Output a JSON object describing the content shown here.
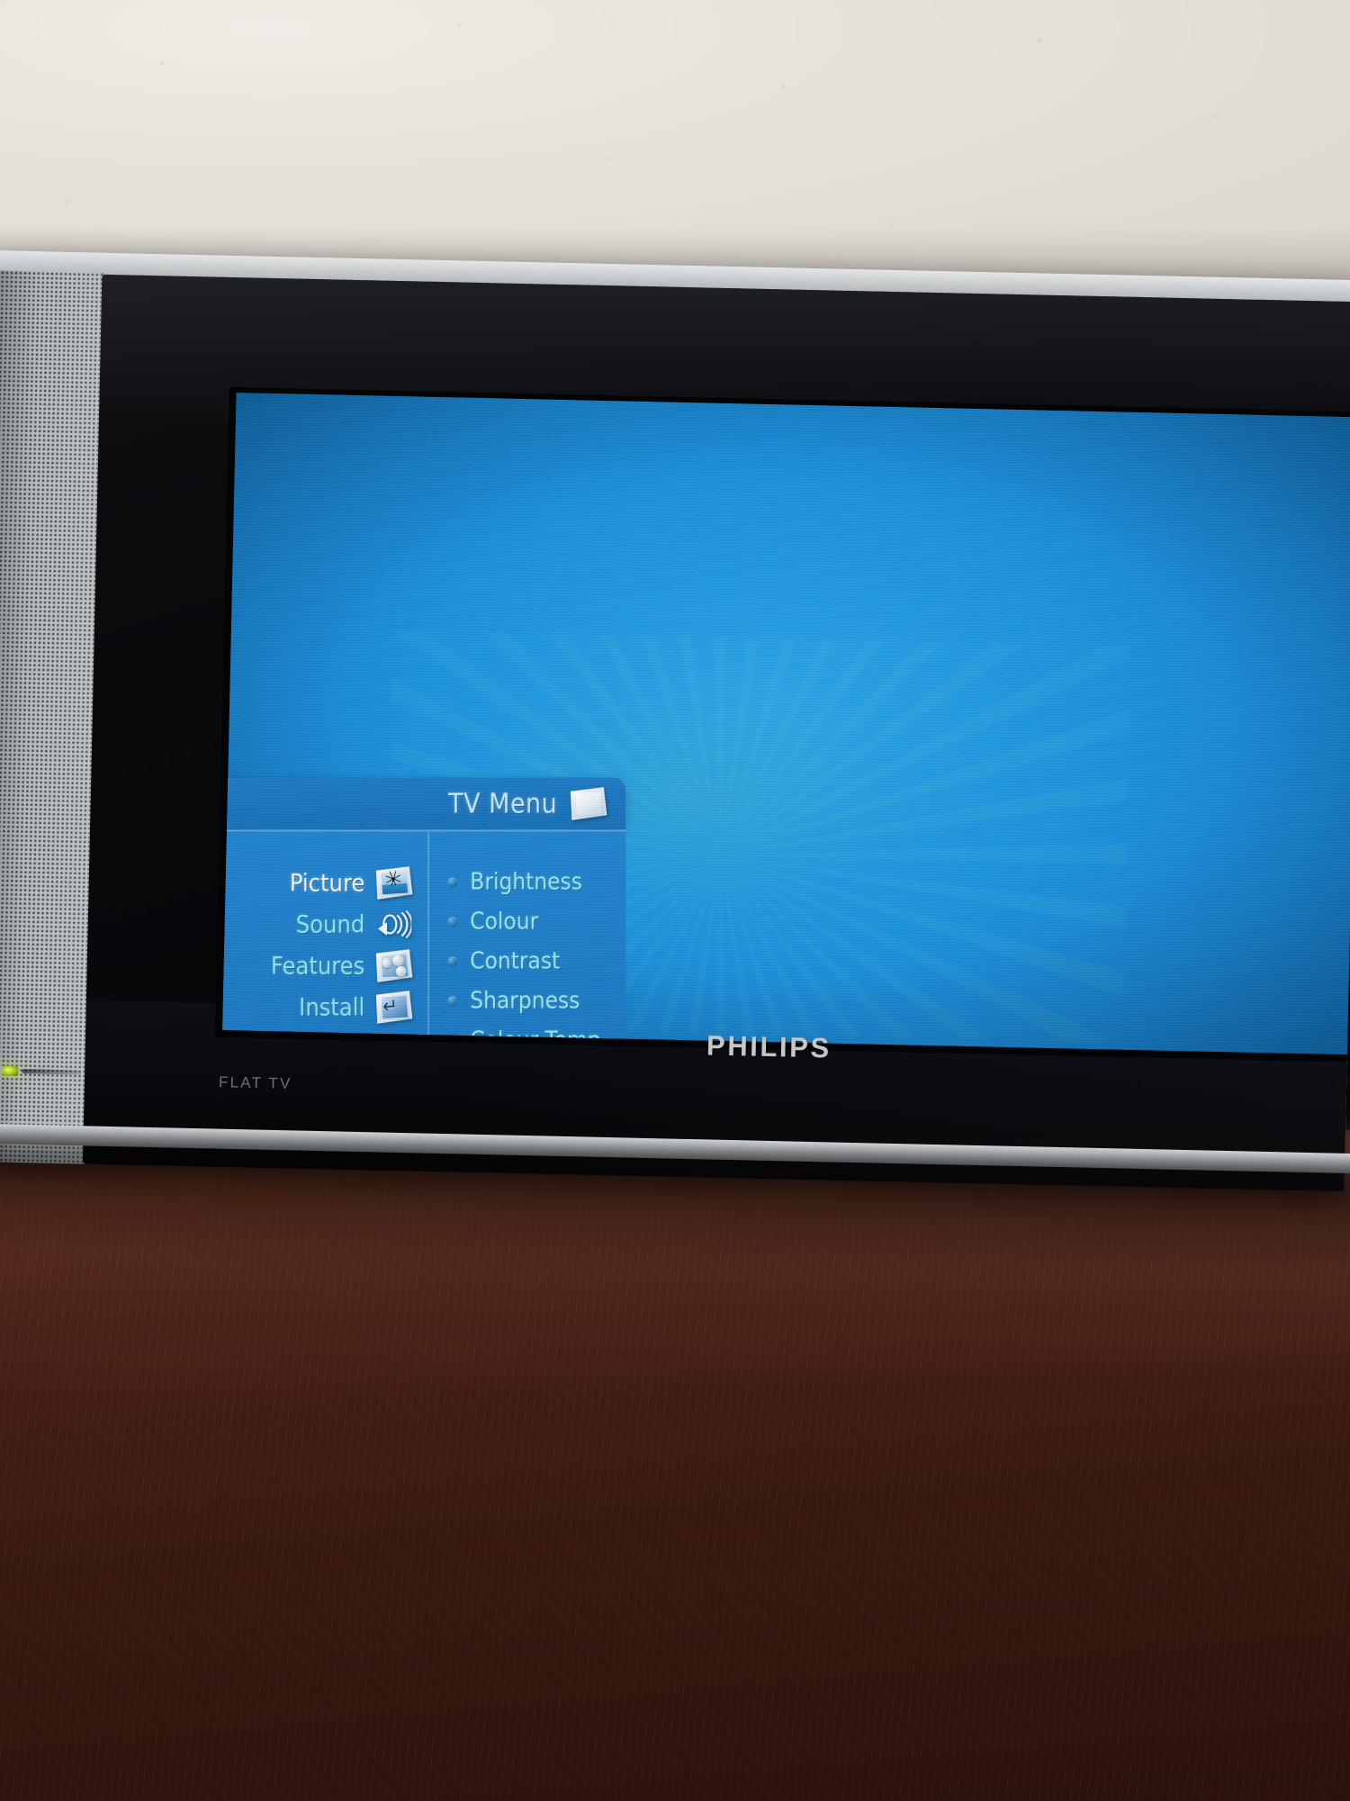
{
  "device": {
    "brand": "PHILIPS",
    "model_label": "FLAT TV",
    "power_led": "power-led"
  },
  "osd": {
    "title": "TV Menu",
    "title_icon": "tv-menu-card-icon",
    "categories": [
      {
        "label": "Picture",
        "icon": "picture-card-icon",
        "selected": true
      },
      {
        "label": "Sound",
        "icon": "speaker-icon",
        "selected": false
      },
      {
        "label": "Features",
        "icon": "features-card-icon",
        "selected": false
      },
      {
        "label": "Install",
        "icon": "install-card-icon",
        "selected": false
      }
    ],
    "items": [
      {
        "label": "Brightness",
        "bullet": "bullet-icon"
      },
      {
        "label": "Colour",
        "bullet": "bullet-icon"
      },
      {
        "label": "Contrast",
        "bullet": "bullet-icon"
      },
      {
        "label": "Sharpness",
        "bullet": "bullet-icon"
      },
      {
        "label": "Colour Temp",
        "bullet": "bullet-icon"
      }
    ]
  },
  "colors": {
    "osd_panel": "#1d7cc6",
    "osd_header": "#1b76bf",
    "osd_text_cyan": "#8fe3ea",
    "osd_text_selected": "#f2f6f8",
    "screen_blue": "#1c93de",
    "bezel_black": "#0a0a0d",
    "chassis_silver": "#9fa4a7",
    "desk_wood": "#4a2217",
    "wall": "#e6e2da",
    "led_green": "#9bbb1b"
  }
}
